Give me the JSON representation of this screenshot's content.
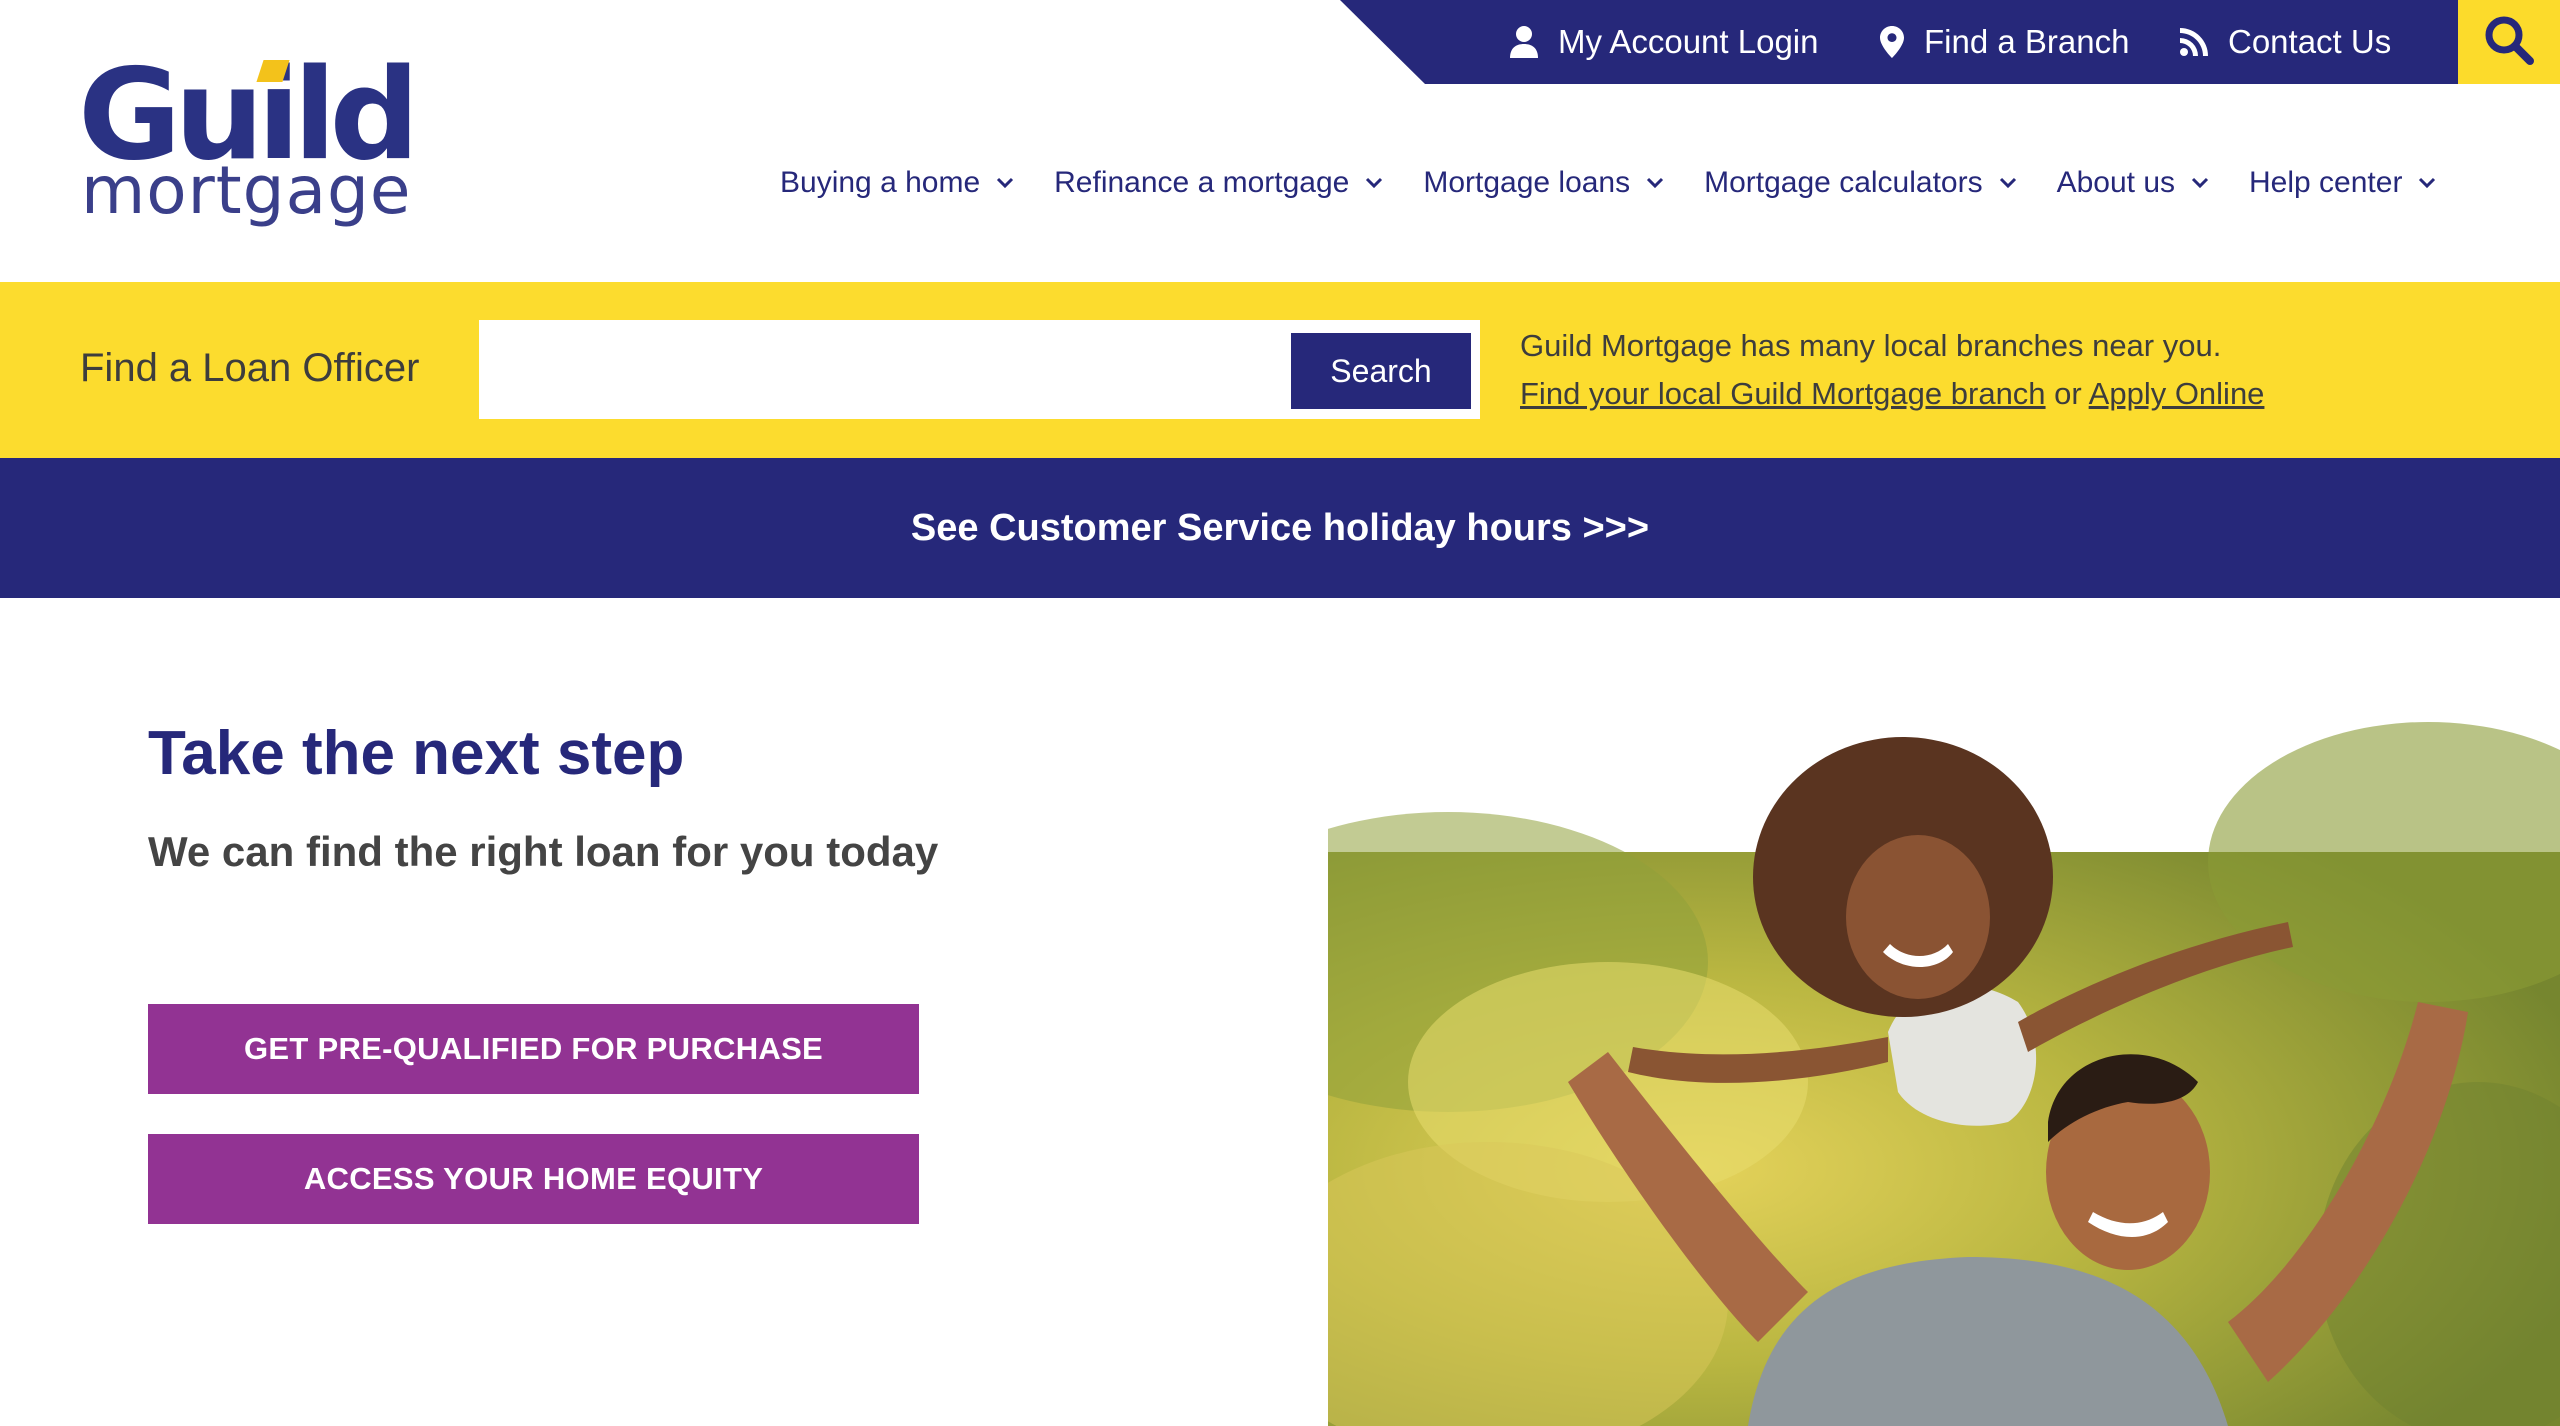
{
  "brand": {
    "logo_word": "Guild",
    "logo_sub": "mortgage",
    "colors": {
      "navy": "#26287a",
      "yellow": "#fcdc2e",
      "purple": "#923393",
      "gray_text": "#444444"
    }
  },
  "utility_nav": {
    "account": {
      "label": "My Account Login",
      "icon": "user-icon"
    },
    "branch": {
      "label": "Find a Branch",
      "icon": "map-pin-icon"
    },
    "contact": {
      "label": "Contact Us",
      "icon": "rss-icon"
    },
    "search_icon": "search-icon"
  },
  "main_nav": [
    {
      "label": "Buying a home"
    },
    {
      "label": "Refinance a mortgage"
    },
    {
      "label": "Mortgage loans"
    },
    {
      "label": "Mortgage calculators"
    },
    {
      "label": "About us"
    },
    {
      "label": "Help center"
    }
  ],
  "loan_officer": {
    "label": "Find a Loan Officer",
    "input_value": "",
    "input_placeholder": "",
    "button_label": "Search",
    "info_text": "Guild Mortgage has many local branches near you.",
    "branch_link": "Find your local Guild Mortgage branch",
    "or_text": "or",
    "apply_link": "Apply Online"
  },
  "announcement": {
    "label": "See Customer Service holiday hours >>>"
  },
  "hero": {
    "title": "Take the next step",
    "subtitle": "We can find the right loan for you today",
    "cta_primary": "GET PRE-QUALIFIED FOR PURCHASE",
    "cta_secondary": "ACCESS YOUR HOME EQUITY"
  }
}
